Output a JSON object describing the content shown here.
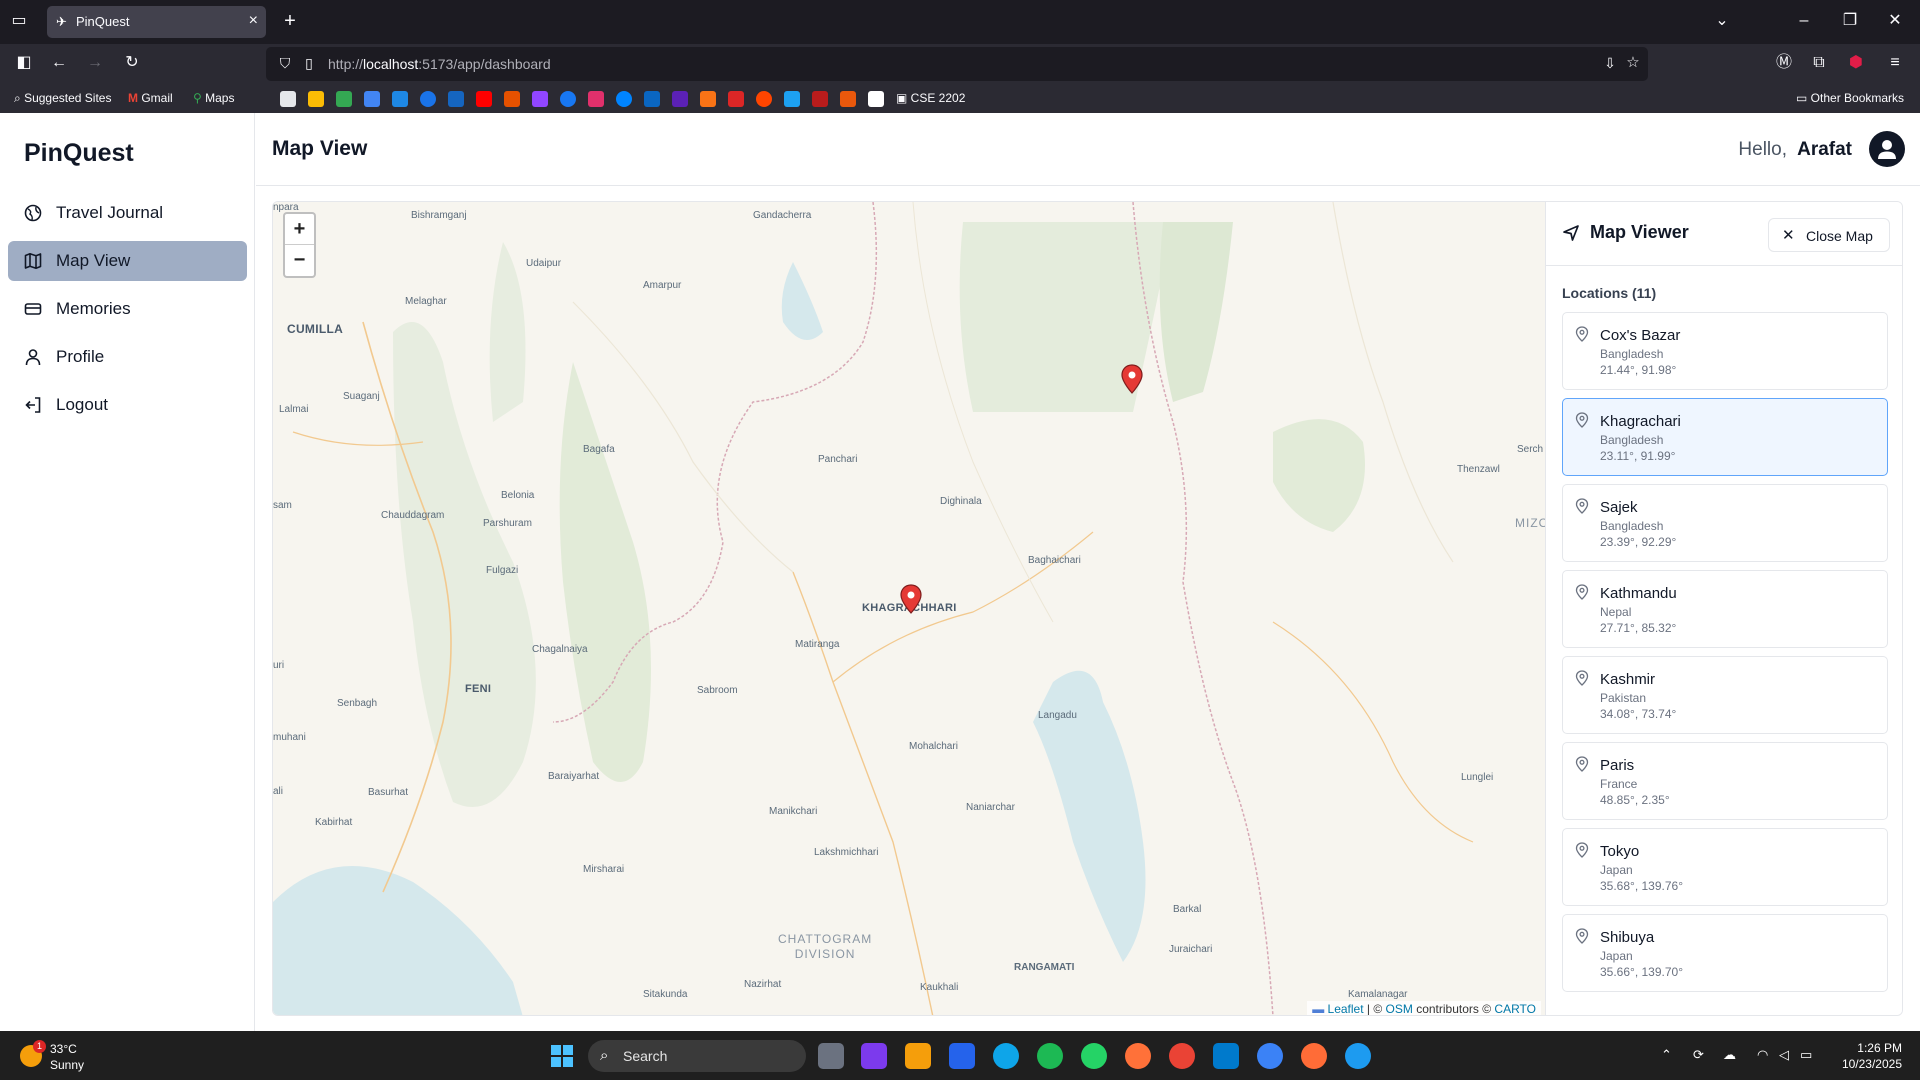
{
  "browser": {
    "tab_title": "PinQuest",
    "url_prefix": "http://",
    "url_host": "localhost",
    "url_rest": ":5173/app/dashboard",
    "bookmarks": {
      "suggested": "Suggested Sites",
      "gmail": "Gmail",
      "maps": "Maps",
      "cse": "CSE 2202",
      "other": "Other Bookmarks"
    }
  },
  "app": {
    "brand": "PinQuest",
    "page_title": "Map View",
    "greeting": "Hello,",
    "username": "Arafat",
    "nav": [
      {
        "label": "Travel Journal",
        "icon": "globe-icon"
      },
      {
        "label": "Map View",
        "icon": "map-icon",
        "active": true
      },
      {
        "label": "Memories",
        "icon": "memories-icon"
      },
      {
        "label": "Profile",
        "icon": "user-icon"
      },
      {
        "label": "Logout",
        "icon": "logout-icon"
      }
    ]
  },
  "map": {
    "zoom_in": "+",
    "zoom_out": "−",
    "attribution": {
      "leaflet": "Leaflet",
      "sep": " | © ",
      "osm": "OSM",
      "contrib": " contributors © ",
      "carto": "CARTO"
    },
    "places": {
      "p01": "Bishramganj",
      "p02": "Gandacherra",
      "p03": "Udaipur",
      "p04": "Amarpur",
      "p05": "Melaghar",
      "p06": "CUMILLA",
      "p07": "Suaganj",
      "p08": "Lalmai",
      "p09": "Bagafa",
      "p10": "Panchari",
      "p11": "Belonia",
      "p12": "Parshuram",
      "p13": "Chauddagram",
      "p14": "Dighinala",
      "p15": "Fulgazi",
      "p16": "Baghaichari",
      "p17": "KHAGRACHHARI",
      "p18": "Chagalnaiya",
      "p19": "Matiranga",
      "p20": "FENI",
      "p21": "Sabroom",
      "p22": "Senbagh",
      "p23": "Langadu",
      "p24": "Mohalchari",
      "p25": "Baraiyarhat",
      "p26": "Basurhat",
      "p27": "Naniarchar",
      "p28": "Kabirhat",
      "p29": "Manikchari",
      "p30": "Lakshmichhari",
      "p31": "Mirsharai",
      "p32": "Thenzawl",
      "p33": "Lunglei",
      "p34": "Barkal",
      "p35": "Juraichari",
      "p36": "RANGAMATI",
      "p37": "Kaukhali",
      "p38": "Nazirhat",
      "p39": "Sitakunda",
      "p40": "Kamalanagar",
      "p41": "MIZO",
      "p42": "Serch",
      "p43": "sam",
      "p44": "uri",
      "p45": "muhani",
      "p46": "ali",
      "p47": "npara",
      "division": "CHATTOGRAM\nDIVISION"
    }
  },
  "viewer": {
    "title": "Map Viewer",
    "close_label": "Close Map",
    "locations_label": "Locations (11)",
    "locations": [
      {
        "name": "Cox's Bazar",
        "country": "Bangladesh",
        "coords": "21.44°, 91.98°"
      },
      {
        "name": "Khagrachari",
        "country": "Bangladesh",
        "coords": "23.11°, 91.99°",
        "selected": true
      },
      {
        "name": "Sajek",
        "country": "Bangladesh",
        "coords": "23.39°, 92.29°"
      },
      {
        "name": "Kathmandu",
        "country": "Nepal",
        "coords": "27.71°, 85.32°"
      },
      {
        "name": "Kashmir",
        "country": "Pakistan",
        "coords": "34.08°, 73.74°"
      },
      {
        "name": "Paris",
        "country": "France",
        "coords": "48.85°, 2.35°"
      },
      {
        "name": "Tokyo",
        "country": "Japan",
        "coords": "35.68°, 139.76°"
      },
      {
        "name": "Shibuya",
        "country": "Japan",
        "coords": "35.66°, 139.70°"
      }
    ]
  },
  "taskbar": {
    "temp": "33°C",
    "condition": "Sunny",
    "weather_badge": "1",
    "search": "Search",
    "time": "1:26 PM",
    "date": "10/23/2025"
  },
  "colors": {
    "accent_active_nav": "#9fadc4",
    "marker_red": "#e53935",
    "selected_bg": "#eff6ff",
    "selected_border": "#60a5fa"
  }
}
